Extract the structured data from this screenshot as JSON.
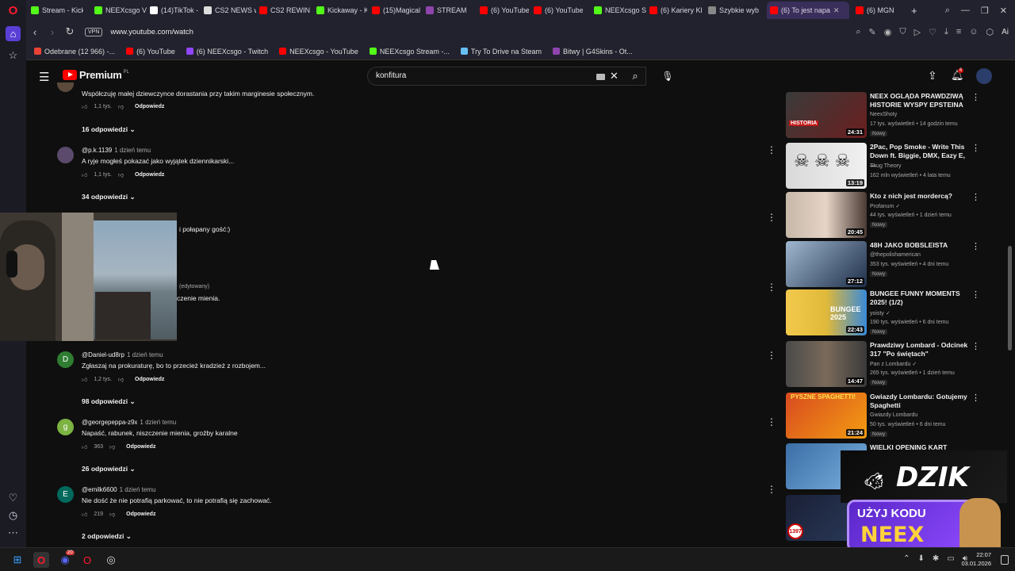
{
  "browser": {
    "tabs": [
      {
        "label": "Stream - Kick",
        "color": "#53fc18"
      },
      {
        "label": "NEEXcsgo Vid",
        "color": "#53fc18"
      },
      {
        "label": "(14)TikTok - M",
        "color": "#ffffff"
      },
      {
        "label": "CS2 NEWS w",
        "color": "#ffffff"
      },
      {
        "label": "CS2 REWIND",
        "color": "#ff0000"
      },
      {
        "label": "Kickaway - Ki",
        "color": "#53fc18"
      },
      {
        "label": "(15)Magical K",
        "color": "#ff0000"
      },
      {
        "label": "STREAM",
        "color": "#8e44ad"
      },
      {
        "label": "(6) YouTube",
        "color": "#ff0000"
      },
      {
        "label": "(6) YouTube",
        "color": "#ff0000"
      },
      {
        "label": "NEEXcsgo Str",
        "color": "#53fc18"
      },
      {
        "label": "(6) Kariery Kl",
        "color": "#ff0000"
      },
      {
        "label": "Szybkie wybi",
        "color": "#888888"
      },
      {
        "label": "(6) To jest napa",
        "color": "#ff0000"
      },
      {
        "label": "(6) MGN",
        "color": "#ff0000"
      }
    ],
    "new_tab": "+",
    "url": "www.youtube.com/watch",
    "vpn_label": "VPN",
    "ai_label": "Ai",
    "bookmarks": [
      {
        "label": "Odebrane (12 966) -...",
        "color": "#ea4335"
      },
      {
        "label": "(6) YouTube",
        "color": "#ff0000"
      },
      {
        "label": "(6) NEEXcsgo - Twitch",
        "color": "#9146ff"
      },
      {
        "label": "NEEXcsgo - YouTube",
        "color": "#ff0000"
      },
      {
        "label": "NEEXcsgo Stream -...",
        "color": "#53fc18"
      },
      {
        "label": "Try To Drive na Steam",
        "color": "#66c0f4"
      },
      {
        "label": "Bitwy | G4Skins - Ot...",
        "color": "#8e44ad"
      }
    ]
  },
  "header": {
    "logo_text": "Premium",
    "logo_region": "PL",
    "search_value": "konfitura",
    "notif_count": "6"
  },
  "comments": [
    {
      "text": "Współczuję małej dziewczynce dorastania przy takim marginesie społecznym.",
      "likes": "1,1 tys.",
      "reply": "Odpowiedz",
      "replies": "16 odpowiedzi"
    },
    {
      "author": "@p.k.1139",
      "ago": "1 dzień temu",
      "text": "A ryje mogłeś pokazać jako wyjątek dziennikarski...",
      "likes": "1,1 tys.",
      "reply": "Odpowiedz",
      "replies": "34 odpowiedzi",
      "avatar_color": "#5b4a6b"
    },
    {
      "author": "@Daniel-ud8rp",
      "ago": "1 dzień temu",
      "text": "Zgłaszaj na prokuraturę, bo to przecież kradzież z rozbojem...",
      "likes": "1,2 tys.",
      "reply": "Odpowiedz",
      "replies": "98 odpowiedzi",
      "avatar_letter": "D",
      "avatar_color": "#2e7d32"
    },
    {
      "author": "@georgepeppa-z9x",
      "ago": "1 dzień temu",
      "text": "Napaść, rabunek, niszczenie mienia, groźby karalne",
      "likes": "363",
      "reply": "Odpowiedz",
      "replies": "26 odpowiedzi",
      "avatar_letter": "g",
      "avatar_color": "#7cb342"
    },
    {
      "author": "@emilk6600",
      "ago": "1 dzień temu",
      "text": "Nie dość że nie potrafią parkować,  to nie potrafią się zachować.",
      "likes": "219",
      "reply": "Odpowiedz",
      "replies": "2 odpowiedzi",
      "avatar_letter": "E",
      "avatar_color": "#00695c"
    }
  ],
  "hidden_fragments": {
    "frag1": "i połapany gość:)",
    "frag2": "(edytowany)",
    "frag3": "czenie mienia."
  },
  "videos": [
    {
      "title": "NEEX OGLĄDA PRAWDZIWĄ HISTORIE WYSPY EPSTEINA",
      "channel": "NeexShoty",
      "meta": "17 tys. wyświetleń • 14 godzin temu",
      "badge": "Nowy",
      "duration": "24:31",
      "thumb": "#6b1e1e",
      "thumb_text": "HISTORIA"
    },
    {
      "title": "2Pac, Pop Smoke - Write This Down ft. Biggie, DMX, Eazy E, ...",
      "channel": "Thug Theory",
      "meta": "162 mln wyświetleń • 4 lata temu",
      "duration": "13:19",
      "thumb": "#d9d9d9"
    },
    {
      "title": "Kto z nich jest mordercą?",
      "channel": "Profanum",
      "meta": "44 tys. wyświetleń • 1 dzień temu",
      "badge": "Nowy",
      "duration": "20:45",
      "thumb": "#b0a49a",
      "verified": "✓"
    },
    {
      "title": "48H JAKO BOBSLEISTA",
      "channel": "@thepolishamerican",
      "meta": "353 tys. wyświetleń • 4 dni temu",
      "badge": "Nowy",
      "duration": "27:12",
      "thumb": "#9fb7cf"
    },
    {
      "title": "BUNGEE FUNNY MOMENTS 2025! (1/2)",
      "channel": "yoisty",
      "meta": "190 tys. wyświetleń • 6 dni temu",
      "badge": "Nowy",
      "duration": "22:43",
      "thumb": "#e0b93a",
      "thumb_text": "BUNGEE 2025",
      "verified": "✓"
    },
    {
      "title": "Prawdziwy Lombard - Odcinek 317 \"Po świętach\"",
      "channel": "Pan z Lombardu",
      "meta": "265 tys. wyświetleń • 1 dzień temu",
      "badge": "Nowy",
      "duration": "14:47",
      "thumb": "#5a5a5a",
      "verified": "✓"
    },
    {
      "title": "Gwiazdy Lombardu: Gotujemy Spaghetti",
      "channel": "Gwiazdy Lombardu",
      "meta": "50 tys. wyświetleń • 6 dni temu",
      "badge": "Nowy",
      "duration": "21:24",
      "thumb": "#d84a1f",
      "thumb_text": "PYSZNE SPAGHETTI!"
    },
    {
      "title": "WIELKI OPENING KART",
      "thumb": "#3a6ea5"
    },
    {
      "thumb": "#2a2a3a",
      "thumb_text": "1397"
    }
  ],
  "ad": {
    "brand": "DZIK",
    "line1": "UŻYJ KODU",
    "line2": "NEEX"
  },
  "taskbar": {
    "time": "22:07",
    "date": "03.01.2026",
    "discord_badge": "20"
  }
}
